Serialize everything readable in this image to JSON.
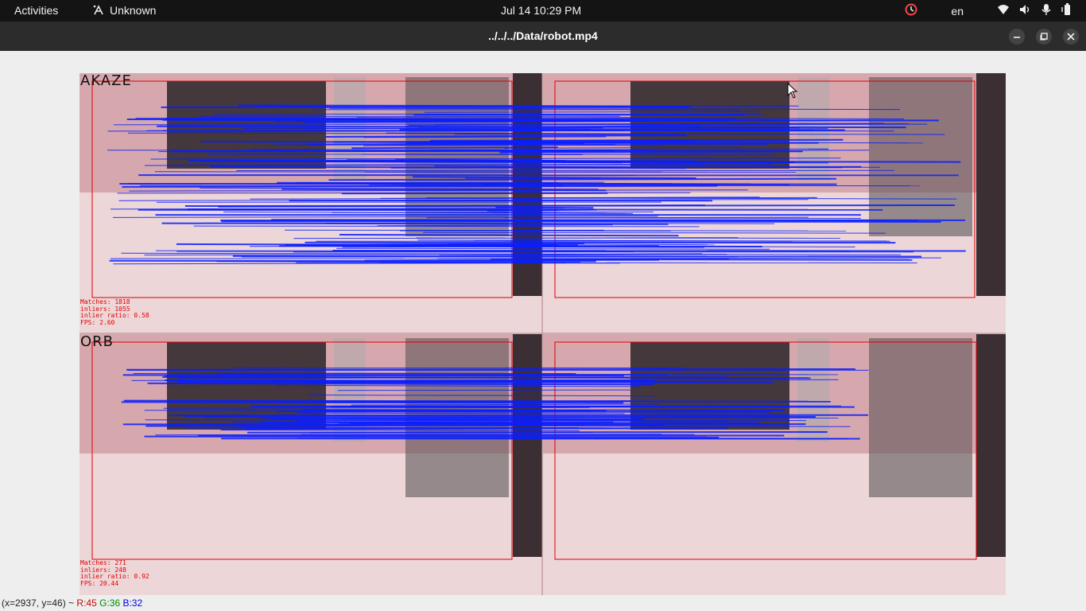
{
  "topbar": {
    "activities": "Activities",
    "app_name": "Unknown",
    "clock": "Jul 14  10:29 PM",
    "language": "en"
  },
  "window": {
    "title": "../../../Data/robot.mp4"
  },
  "panels": {
    "top": {
      "algorithm": "AKAZE",
      "stats": [
        "Matches: 1818",
        "inliers: 1055",
        "inlier ratio: 0.58",
        "FPS: 2.60"
      ]
    },
    "bottom": {
      "algorithm": "ORB",
      "stats": [
        "Matches: 271",
        "inliers: 248",
        "inlier ratio: 0.92",
        "FPS: 20.44"
      ]
    }
  },
  "statusbar": {
    "coords": "(x=2937, y=46) ~",
    "r": "R:45",
    "g": "G:36",
    "b": "B:32"
  },
  "colors": {
    "match_lines": "#0a1eff",
    "bbox": "#e00000",
    "frame_tint": "#e9c9cd"
  }
}
